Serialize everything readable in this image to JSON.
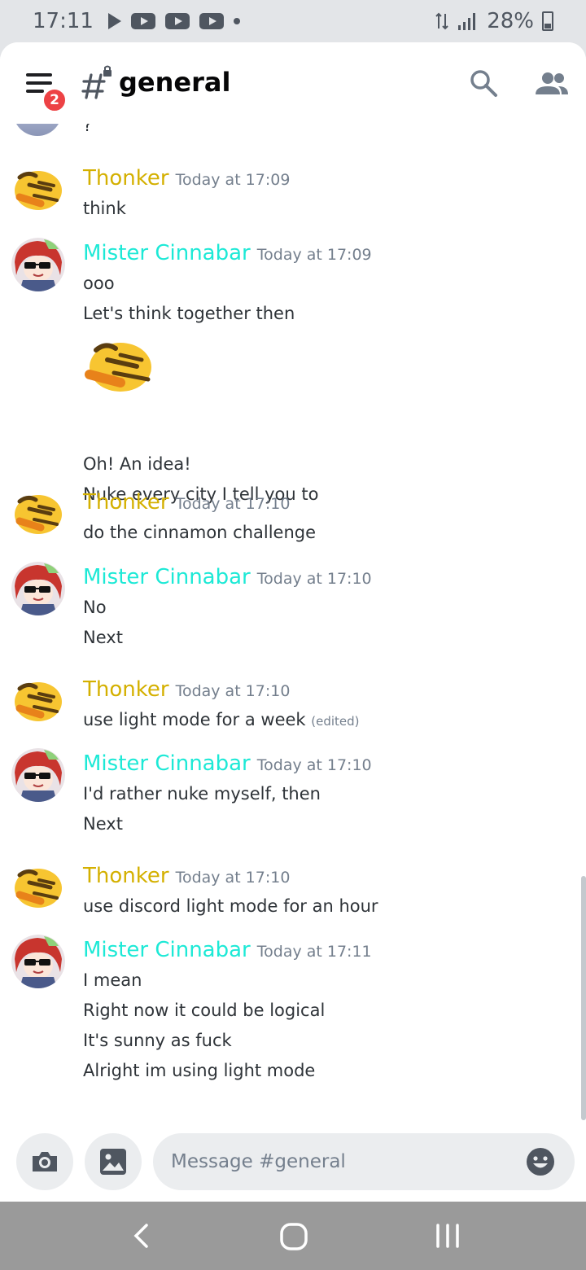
{
  "status_bar": {
    "time": "17:11",
    "battery": "28%"
  },
  "header": {
    "channel": "general",
    "notification_count": "2"
  },
  "partial_message": {
    "text": "?"
  },
  "messages": [
    {
      "author": "Thonker",
      "time": "Today at 17:09",
      "lines": [
        "think"
      ]
    },
    {
      "author": "Mister Cinnabar",
      "time": "Today at 17:09",
      "lines": [
        "ooo",
        "Let's think together then",
        "Oh! An idea!",
        "Nuke every city I tell you to"
      ]
    },
    {
      "author": "Thonker",
      "time": "Today at 17:10",
      "lines": [
        "do the cinnamon challenge"
      ]
    },
    {
      "author": "Mister Cinnabar",
      "time": "Today at 17:10",
      "lines": [
        "No",
        "Next"
      ]
    },
    {
      "author": "Thonker",
      "time": "Today at 17:10",
      "lines": [
        "use light mode for a week"
      ],
      "edited": "(edited)"
    },
    {
      "author": "Mister Cinnabar",
      "time": "Today at 17:10",
      "lines": [
        "I'd rather nuke myself, then",
        "Next"
      ]
    },
    {
      "author": "Thonker",
      "time": "Today at 17:10",
      "lines": [
        "use discord light mode for an hour"
      ]
    },
    {
      "author": "Mister Cinnabar",
      "time": "Today at 17:11",
      "lines": [
        "I mean",
        "Right now it could be logical",
        "It's sunny as fuck",
        "Alright im using light mode"
      ]
    }
  ],
  "input": {
    "placeholder": "Message #general"
  },
  "colors": {
    "thonker": "#d4b000",
    "cinnabar": "#1de9d6",
    "badge": "#ed4245"
  }
}
